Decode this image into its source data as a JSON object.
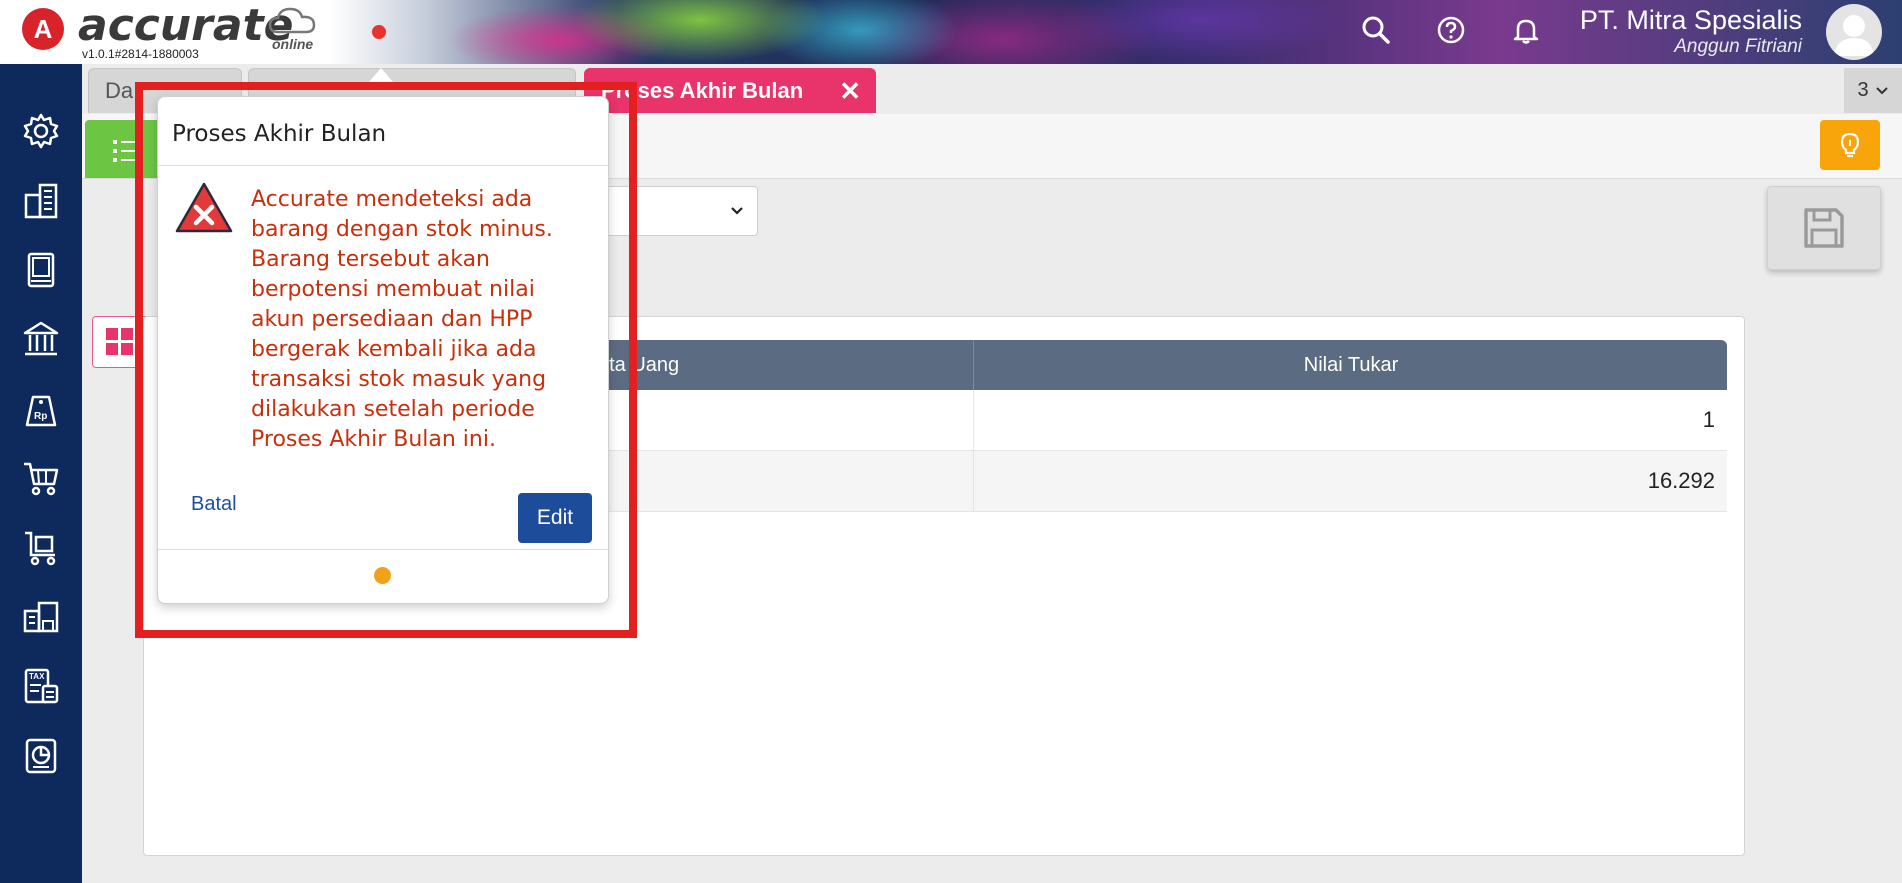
{
  "app": {
    "logo_letter": "A",
    "logo_text": "accurate",
    "logo_sub": "online",
    "version": "v1.0.1#2814-1880003"
  },
  "header": {
    "company": "PT. Mitra Spesialis",
    "user": "Anggun Fitriani",
    "icons": [
      "search-icon",
      "help-icon",
      "bell-icon",
      "avatar"
    ]
  },
  "sidebar": {
    "items": [
      {
        "icon": "gear-icon"
      },
      {
        "icon": "building-icon"
      },
      {
        "icon": "book-icon"
      },
      {
        "icon": "bank-icon"
      },
      {
        "icon": "price-tag-icon",
        "label": "Rp"
      },
      {
        "icon": "cart-icon"
      },
      {
        "icon": "purchase-icon"
      },
      {
        "icon": "warehouse-icon"
      },
      {
        "icon": "tax-icon",
        "label": "TAX"
      },
      {
        "icon": "report-chart-icon"
      }
    ]
  },
  "tabs": {
    "items": [
      {
        "label": "Da"
      },
      {
        "label": ""
      },
      {
        "label": "Proses Akhir Bulan",
        "active": true
      }
    ],
    "count": "3"
  },
  "table": {
    "headers": [
      "ata Uang",
      "Nilai Tukar"
    ],
    "rows": [
      {
        "rate": "1"
      },
      {
        "rate": "16.292"
      }
    ]
  },
  "popup": {
    "title": "Proses Akhir Bulan",
    "message": "Accurate mendeteksi ada barang dengan stok minus. Barang tersebut akan berpotensi membuat nilai akun persediaan dan HPP bergerak kembali jika ada transaksi stok masuk yang dilakukan setelah periode Proses Akhir Bulan ini.",
    "cancel_label": "Batal",
    "edit_label": "Edit"
  },
  "colors": {
    "sidebar": "#0e2a5c",
    "active_tab": "#e8336b",
    "highlight": "#e3201f",
    "message_text": "#c8300c",
    "edit_button": "#1d4c9b"
  }
}
